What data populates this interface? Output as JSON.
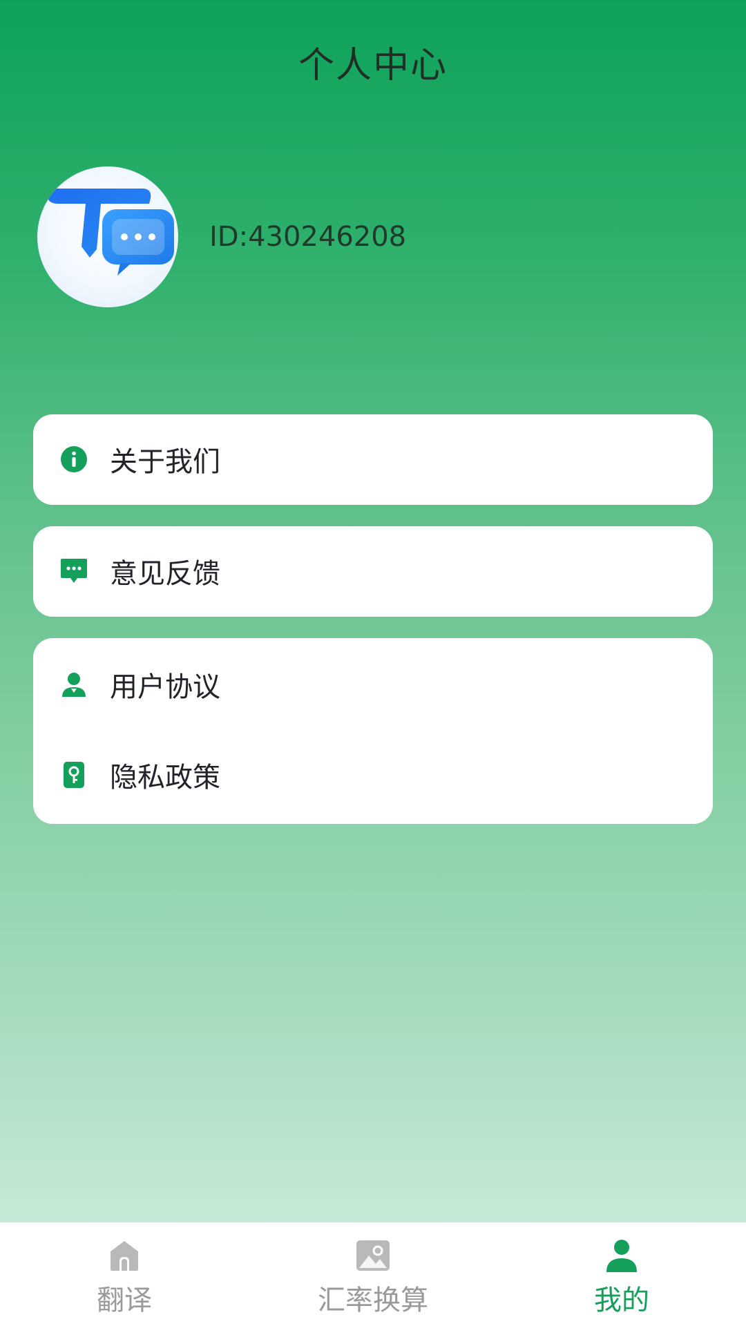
{
  "header": {
    "title": "个人中心"
  },
  "profile": {
    "user_id": "ID:430246208",
    "avatar_icon": "translate-chat-logo-icon"
  },
  "menu": {
    "about": {
      "label": "关于我们",
      "icon": "info-icon"
    },
    "feedback": {
      "label": "意见反馈",
      "icon": "message-icon"
    },
    "agreement": {
      "label": "用户协议",
      "icon": "user-icon"
    },
    "privacy": {
      "label": "隐私政策",
      "icon": "key-icon"
    }
  },
  "bottom_nav": {
    "items": [
      {
        "label": "翻译",
        "icon": "home-icon",
        "active": false
      },
      {
        "label": "汇率换算",
        "icon": "image-icon",
        "active": false
      },
      {
        "label": "我的",
        "icon": "person-icon",
        "active": true
      }
    ]
  },
  "colors": {
    "accent": "#14a05a",
    "inactive": "#9a9a9a",
    "gradient_top": "#0da25a",
    "gradient_bottom": "#d6efe2"
  }
}
